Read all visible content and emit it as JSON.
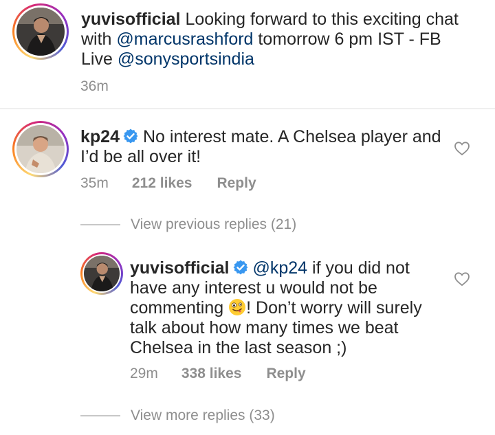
{
  "caption": {
    "username": "yuvisofficial",
    "text_1": " Looking forward to this exciting chat with ",
    "mention_1": "@marcusrashford",
    "text_2": " tomorrow 6 pm IST - FB Live ",
    "mention_2": "@sonysportsindia",
    "time": "36m"
  },
  "comment": {
    "username": "kp24",
    "verified": true,
    "text": "No interest mate. A Chelsea player and I’d be all over it!",
    "time": "35m",
    "likes": "212 likes",
    "reply_label": "Reply",
    "view_previous": "View previous replies (21)"
  },
  "reply": {
    "username": "yuvisofficial",
    "verified": true,
    "mention": "@kp24",
    "text_1": " if you did not have any interest u would not be commenting ",
    "emoji": "zany-face-emoji",
    "text_2": "! Don’t worry will surely talk about how many times we beat Chelsea in the last season ;)",
    "time": "29m",
    "likes": "338 likes",
    "reply_label": "Reply",
    "view_more": "View more replies (33)"
  },
  "colors": {
    "mention": "#003569",
    "verified_badge": "#3897f0",
    "meta_text": "#8e8e8e",
    "ring_start": "#feda75",
    "ring_end": "#962fbf"
  }
}
